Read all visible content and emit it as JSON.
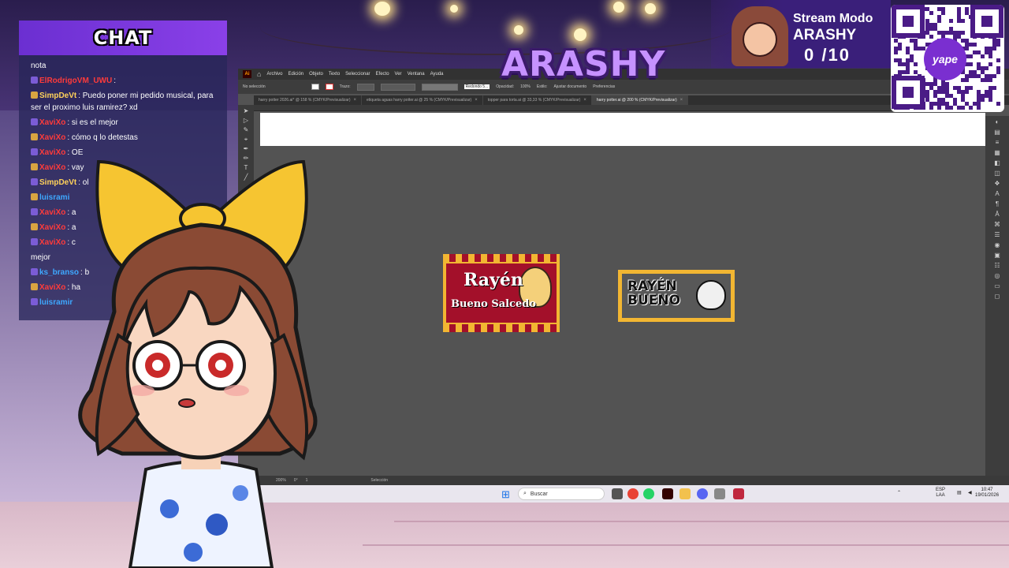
{
  "colors": {
    "chat_header": "#7a38e0",
    "brand": "#c692ff",
    "label_red": "#a3102a",
    "label_gold": "#f2b632"
  },
  "chat": {
    "title": "CHAT",
    "messages": [
      {
        "user": "",
        "text": "nota",
        "user_color": "#ffffff"
      },
      {
        "user": "ElRodrigoVM_UWU",
        "text": ":",
        "user_color": "#ff3b3b"
      },
      {
        "user": "SimpDeVt",
        "text": ": Puedo poner mi pedido musical, para ser el proximo luis ramirez? xd",
        "user_color": "#ffd25a"
      },
      {
        "user": "XaviXo",
        "text": ": si es el mejor",
        "user_color": "#ff3b3b"
      },
      {
        "user": "XaviXo",
        "text": ": cómo q lo detestas",
        "user_color": "#ff3b3b"
      },
      {
        "user": "XaviXo",
        "text": ": OE",
        "user_color": "#ff3b3b"
      },
      {
        "user": "XaviXo",
        "text": ": vay",
        "user_color": "#ff3b3b"
      },
      {
        "user": "SimpDeVt",
        "text": ": ol",
        "user_color": "#ffd25a"
      },
      {
        "user": "luisrami",
        "text": "",
        "user_color": "#3ea8ff"
      },
      {
        "user": "XaviXo",
        "text": ": a",
        "user_color": "#ff3b3b"
      },
      {
        "user": "XaviXo",
        "text": ": a",
        "user_color": "#ff3b3b"
      },
      {
        "user": "XaviXo",
        "text": ": c",
        "user_color": "#ff3b3b"
      },
      {
        "user": "",
        "text": "mejor",
        "user_color": "#ffffff"
      },
      {
        "user": "ks_branso",
        "text": ": b",
        "user_color": "#3ea8ff"
      },
      {
        "user": "XaviXo",
        "text": ": ha",
        "user_color": "#ff3b3b"
      },
      {
        "user": "luisramir",
        "text": "",
        "user_color": "#3ea8ff"
      }
    ]
  },
  "illustrator": {
    "logo": "Ai",
    "menus": [
      "Archivo",
      "Edición",
      "Objeto",
      "Texto",
      "Seleccionar",
      "Efecto",
      "Ver",
      "Ventana",
      "Ayuda"
    ],
    "control": {
      "selection": "No selección",
      "stroke_label": "Trazo:",
      "opacity_label": "Opacidad:",
      "opacity_value": "100%",
      "style_label": "Estilo:",
      "doc_button": "Ajustar documento",
      "prefs_button": "Preferencias",
      "shape": "Redondo 5..."
    },
    "tabs": [
      {
        "label": "harry potter 2026.ai* @ 158 % (CMYK/Previsualizar)",
        "active": false
      },
      {
        "label": "etiqueta aguas harry potter.ai @ 25 % (CMYK/Previsualizar)",
        "active": false
      },
      {
        "label": "topper para torta.ai @ 33,33 % (CMYK/Previsualizar)",
        "active": false
      },
      {
        "label": "harry potter.ai @ 200 % (CMYK/Previsualizar)",
        "active": true
      }
    ],
    "tab_close": "×",
    "tools": [
      "➤",
      "▷",
      "✎",
      "⌖",
      "✒",
      "✏",
      "T",
      "╱"
    ],
    "right_panel": [
      "◐",
      "▤",
      "≡",
      "▦",
      "◧",
      "◫",
      "❖",
      "A",
      "¶",
      "Ā",
      "⌘",
      "☰",
      "◉",
      "▣",
      "☷",
      "◎",
      "▭",
      "◻"
    ],
    "status": {
      "zoom": "200%",
      "angle": "0°",
      "page": "1",
      "tool": "Selección"
    }
  },
  "artwork": {
    "label1": {
      "name": "Rayén",
      "subtitle": "Bueno Salcedo"
    },
    "label2": {
      "line1": "RAYÉN",
      "line2": "BUENO"
    }
  },
  "taskbar": {
    "search_placeholder": "Buscar",
    "lang": "ESP",
    "lang_sub": "LAA",
    "time": "10:47",
    "date": "19/01/2026"
  },
  "overlay": {
    "brand": "ARASHY",
    "stream_title": "Stream Modo",
    "stream_name": "ARASHY",
    "counter": "0  /10",
    "qr_label": "yape"
  }
}
